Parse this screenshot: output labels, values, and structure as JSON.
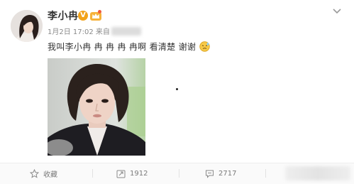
{
  "post": {
    "author": "李小冉",
    "verified_badge": "V",
    "timestamp": "1月2日 17:02",
    "source_prefix": "来自",
    "text": "我叫李小冉 冉 冉 冉 冉啊 看清楚 谢谢"
  },
  "toolbar": {
    "favorite_label": "收藏",
    "repost_count": "1912",
    "comment_count": "2717"
  },
  "icons": {
    "verified": "verified-v-icon",
    "member": "crown-icon",
    "menu": "chevron-down-icon",
    "emoji": "embarrassed-emoji-icon",
    "favorite": "star-icon",
    "repost": "repost-icon",
    "comment": "comment-icon"
  },
  "colors": {
    "verified": "#f2a31a",
    "text": "#333333",
    "meta": "#8a8a8a",
    "toolbar_bg": "#fafafa"
  }
}
